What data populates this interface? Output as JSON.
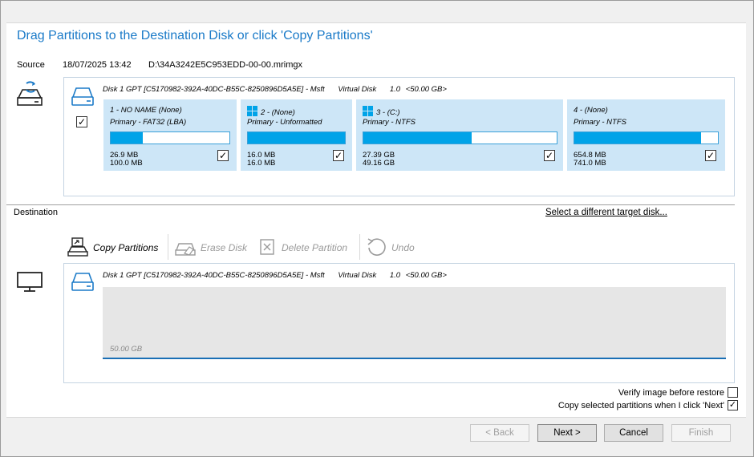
{
  "heading": "Drag Partitions to the Destination Disk or click 'Copy Partitions'",
  "source": {
    "label": "Source",
    "date": "18/07/2025 13:42",
    "path": "D:\\34A3242E5C953EDD-00-00.mrimgx",
    "disk": {
      "name": "Disk 1 GPT [C5170982-392A-40DC-B55C-8250896D5A5E] - Msft",
      "kind": "Virtual Disk",
      "version": "1.0",
      "size": "<50.00 GB>"
    },
    "partitions": [
      {
        "title": "1 - NO NAME (None)",
        "type": "Primary - FAT32 (LBA)",
        "used": "26.9 MB",
        "total": "100.0 MB",
        "fill": 0.27,
        "checked": true,
        "win_icon": false
      },
      {
        "title": "2 -  (None)",
        "type": "Primary - Unformatted",
        "used": "16.0 MB",
        "total": "16.0 MB",
        "fill": 1.0,
        "checked": true,
        "win_icon": true
      },
      {
        "title": "3 -  (C:)",
        "type": "Primary - NTFS",
        "used": "27.39 GB",
        "total": "49.16 GB",
        "fill": 0.56,
        "checked": true,
        "win_icon": true
      },
      {
        "title": "4 -  (None)",
        "type": "Primary - NTFS",
        "used": "654.8 MB",
        "total": "741.0 MB",
        "fill": 0.88,
        "checked": true,
        "win_icon": false
      }
    ]
  },
  "destination": {
    "label": "Destination",
    "select_link": "Select a different target disk...",
    "disk": {
      "name": "Disk 1 GPT [C5170982-392A-40DC-B55C-8250896D5A5E] - Msft",
      "kind": "Virtual Disk",
      "version": "1.0",
      "size": "<50.00 GB>"
    },
    "unallocated": "50.00 GB"
  },
  "toolbar": {
    "copy": "Copy Partitions",
    "erase": "Erase Disk",
    "delete": "Delete Partition",
    "undo": "Undo"
  },
  "options": {
    "verify": "Verify image before restore",
    "verify_checked": false,
    "copy_next": "Copy selected partitions when I click 'Next'",
    "copy_next_checked": true
  },
  "buttons": {
    "back": "< Back",
    "next": "Next >",
    "cancel": "Cancel",
    "finish": "Finish"
  },
  "colors": {
    "accent": "#1a7ac8",
    "partition_bg": "#cde6f7",
    "bar_fill": "#00a3e8"
  }
}
